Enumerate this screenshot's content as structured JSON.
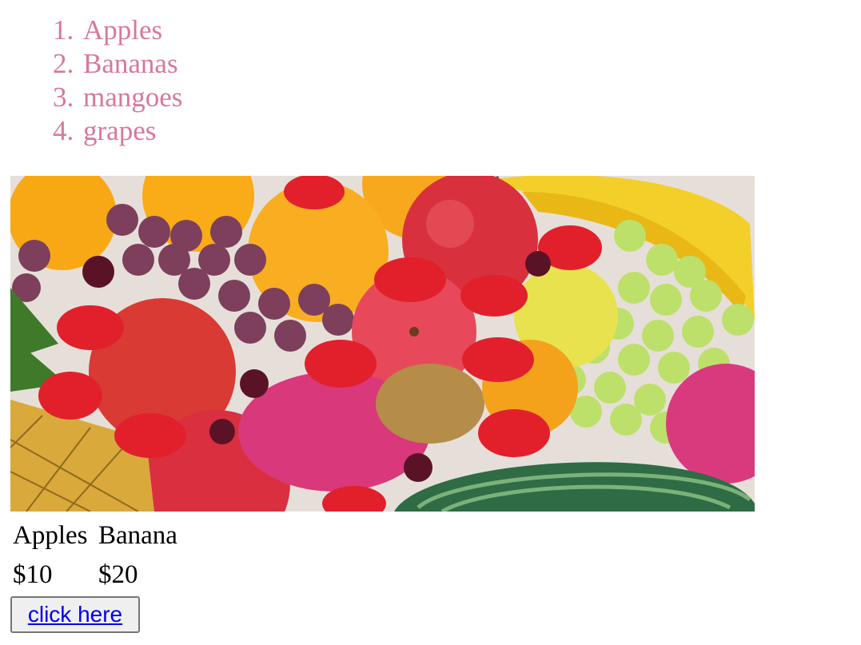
{
  "fruits_list": {
    "items": [
      {
        "number": "1.",
        "label": "Apples"
      },
      {
        "number": "2.",
        "label": "Bananas"
      },
      {
        "number": "3.",
        "label": "mangoes"
      },
      {
        "number": "4.",
        "label": "grapes"
      }
    ],
    "color": "#d9779c"
  },
  "price_table": {
    "headers": [
      "Apples",
      "Banana"
    ],
    "prices": [
      "$10",
      "$20"
    ]
  },
  "button": {
    "link_label": "click here"
  },
  "colors": {
    "link": "#0000ee",
    "button_bg": "#efefef",
    "button_border": "#767676"
  }
}
